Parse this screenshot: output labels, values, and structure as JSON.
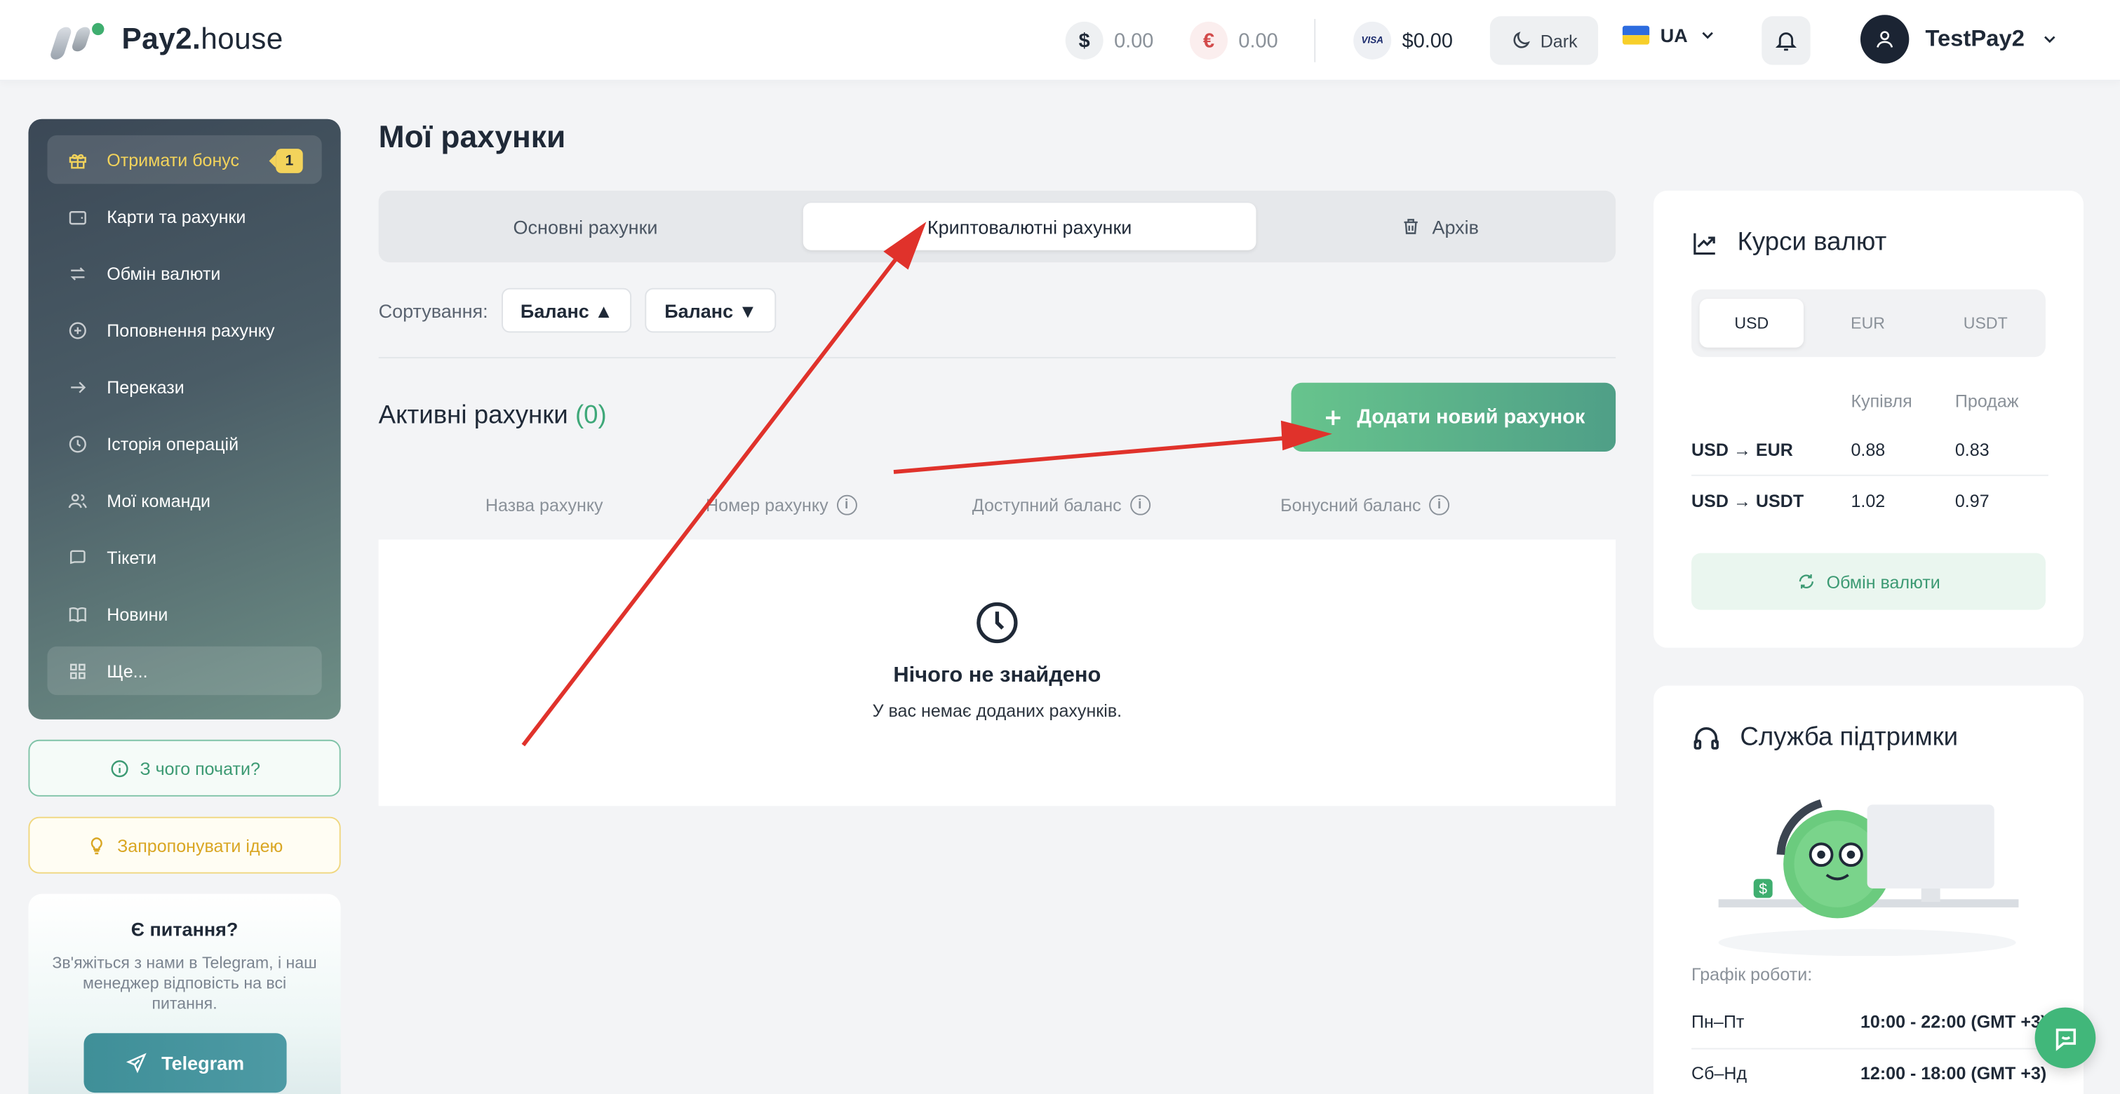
{
  "header": {
    "logo_main": "Pay2.",
    "logo_suffix": "house",
    "balance_usd_symbol": "$",
    "balance_usd": "0.00",
    "balance_eur_symbol": "€",
    "balance_eur": "0.00",
    "visa_label": "VISA",
    "balance_card": "$0.00",
    "theme_label": "Dark",
    "language": "UA",
    "username": "TestPay2"
  },
  "sidebar": {
    "items": [
      {
        "label": "Отримати бонус",
        "badge": "1"
      },
      {
        "label": "Карти та рахунки"
      },
      {
        "label": "Обмін валюти"
      },
      {
        "label": "Поповнення рахунку"
      },
      {
        "label": "Перекази"
      },
      {
        "label": "Історія операцій"
      },
      {
        "label": "Мої команди"
      },
      {
        "label": "Тікети"
      },
      {
        "label": "Новини"
      },
      {
        "label": "Ще..."
      }
    ],
    "start_label": "З чого почати?",
    "idea_label": "Запропонувати ідею",
    "help_title": "Є питання?",
    "help_text": "Зв'яжіться з нами в Telegram, і наш менеджер відповість на всі питання.",
    "telegram_label": "Telegram"
  },
  "main": {
    "title": "Мої рахунки",
    "tabs": [
      {
        "label": "Основні рахунки"
      },
      {
        "label": "Криптовалютні рахунки"
      },
      {
        "label": "Архів"
      }
    ],
    "sort_label": "Сортування:",
    "sort_asc": "Баланс ▲",
    "sort_desc": "Баланс ▼",
    "active_title": "Активні рахунки",
    "active_count": "(0)",
    "add_button": "Додати новий рахунок",
    "columns": [
      "Назва рахунку",
      "Номер рахунку",
      "Доступний баланс",
      "Бонусний баланс"
    ],
    "empty_title": "Нічого не знайдено",
    "empty_sub": "У вас немає доданих рахунків."
  },
  "rates": {
    "title": "Курси валют",
    "tabs": [
      "USD",
      "EUR",
      "USDT"
    ],
    "buy_label": "Купівля",
    "sell_label": "Продаж",
    "rows": [
      {
        "pair": "USD → EUR",
        "buy": "0.88",
        "sell": "0.83"
      },
      {
        "pair": "USD → USDT",
        "buy": "1.02",
        "sell": "0.97"
      }
    ],
    "exchange_button": "Обмін валюти"
  },
  "support": {
    "title": "Служба підтримки",
    "schedule_label": "Графік роботи:",
    "schedule": [
      {
        "days": "Пн–Пт",
        "hours": "10:00 - 22:00 (GMT +3)"
      },
      {
        "days": "Сб–Нд",
        "hours": "12:00 - 18:00 (GMT +3)"
      }
    ]
  },
  "colors": {
    "accent_green": "#41b77a",
    "annotation_red": "#e0322b",
    "bonus_yellow": "#f3d35b"
  }
}
